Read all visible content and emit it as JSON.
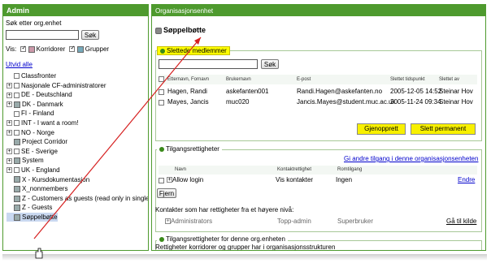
{
  "left": {
    "title": "Admin",
    "search_label": "Søk etter org.enhet",
    "search_button": "Søk",
    "vis_label": "Vis:",
    "corridors_label": "Korridorer",
    "groups_label": "Grupper",
    "expand_all": "Utvid alle",
    "tree": [
      {
        "label": "Classfronter",
        "toggle": "",
        "checkbox": true
      },
      {
        "label": "Nasjonale CF-administratorer",
        "toggle": "+",
        "checkbox": true
      },
      {
        "label": "DE - Deutschland",
        "toggle": "+",
        "checkbox": true
      },
      {
        "label": "DK - Danmark",
        "toggle": "+",
        "checkbox": false
      },
      {
        "label": "FI - Finland",
        "toggle": "",
        "checkbox": true
      },
      {
        "label": "INT - I want a room!",
        "toggle": "+",
        "checkbox": true
      },
      {
        "label": "NO - Norge",
        "toggle": "+",
        "checkbox": true
      },
      {
        "label": "Project Corridor",
        "toggle": "",
        "checkbox": false
      },
      {
        "label": "SE - Sverige",
        "toggle": "+",
        "checkbox": true
      },
      {
        "label": "System",
        "toggle": "+",
        "checkbox": false
      },
      {
        "label": "UK - England",
        "toggle": "+",
        "checkbox": true
      },
      {
        "label": "X - Kursdokumentasjon",
        "toggle": "",
        "checkbox": false
      },
      {
        "label": "X_nonmembers",
        "toggle": "",
        "checkbox": false
      },
      {
        "label": "Z - Customers as guests (read only in single",
        "toggle": "",
        "checkbox": false
      },
      {
        "label": "Z - Guests",
        "toggle": "",
        "checkbox": false
      },
      {
        "label": "Søppelbøtte",
        "toggle": "",
        "checkbox": false
      }
    ]
  },
  "right": {
    "title": "Organisasjonsenhet",
    "unit_name": "Søppelbøtte",
    "deleted_members": {
      "legend": "Slettede medlemmer",
      "search_button": "Søk",
      "columns": [
        "Etternavn, Fornavn",
        "Brukernavn",
        "E-post",
        "Slettet tidspunkt",
        "Slettet av"
      ],
      "rows": [
        [
          "Hagen, Randi",
          "askefanten001",
          "Randi.Hagen@askefanten.no",
          "2005-12-05 14:52",
          "Steinar Hov"
        ],
        [
          "Mayes, Jancis",
          "muc020",
          "Jancis.Mayes@student.muc.ac.uk",
          "2005-11-24 09:34",
          "Steinar Hov"
        ]
      ],
      "restore_button": "Gjenopprett",
      "delete_button": "Slett permanent"
    },
    "access_rights": {
      "legend": "Tilgangsrettigheter",
      "other_access_link": "Gi andre tilgang i denne organisasjonsenheten",
      "columns": [
        "Navn",
        "Kontaktrettighet",
        "Romtilgang"
      ],
      "row": {
        "name": "Allow login",
        "contact": "Vis kontakter",
        "room": "Ingen",
        "edit": "Endre"
      },
      "remove_button": "Fjern",
      "inherited_title": "Kontakter som har rettigheter fra et høyere nivå:",
      "inherited_row": {
        "name": "Administrators",
        "contact": "Topp-admin",
        "room": "Superbruker",
        "goto": "Gå til kilde"
      }
    },
    "this_unit_rights": {
      "legend": "Tilgangsrettigheter for denne org.enheten",
      "text": "Rettigheter korridorer og grupper har i organisasjonsstrukturen"
    }
  },
  "colors": {
    "header_green": "#4e9a2e",
    "highlight_yellow": "#fffe00",
    "arrow_red": "#d62020"
  }
}
